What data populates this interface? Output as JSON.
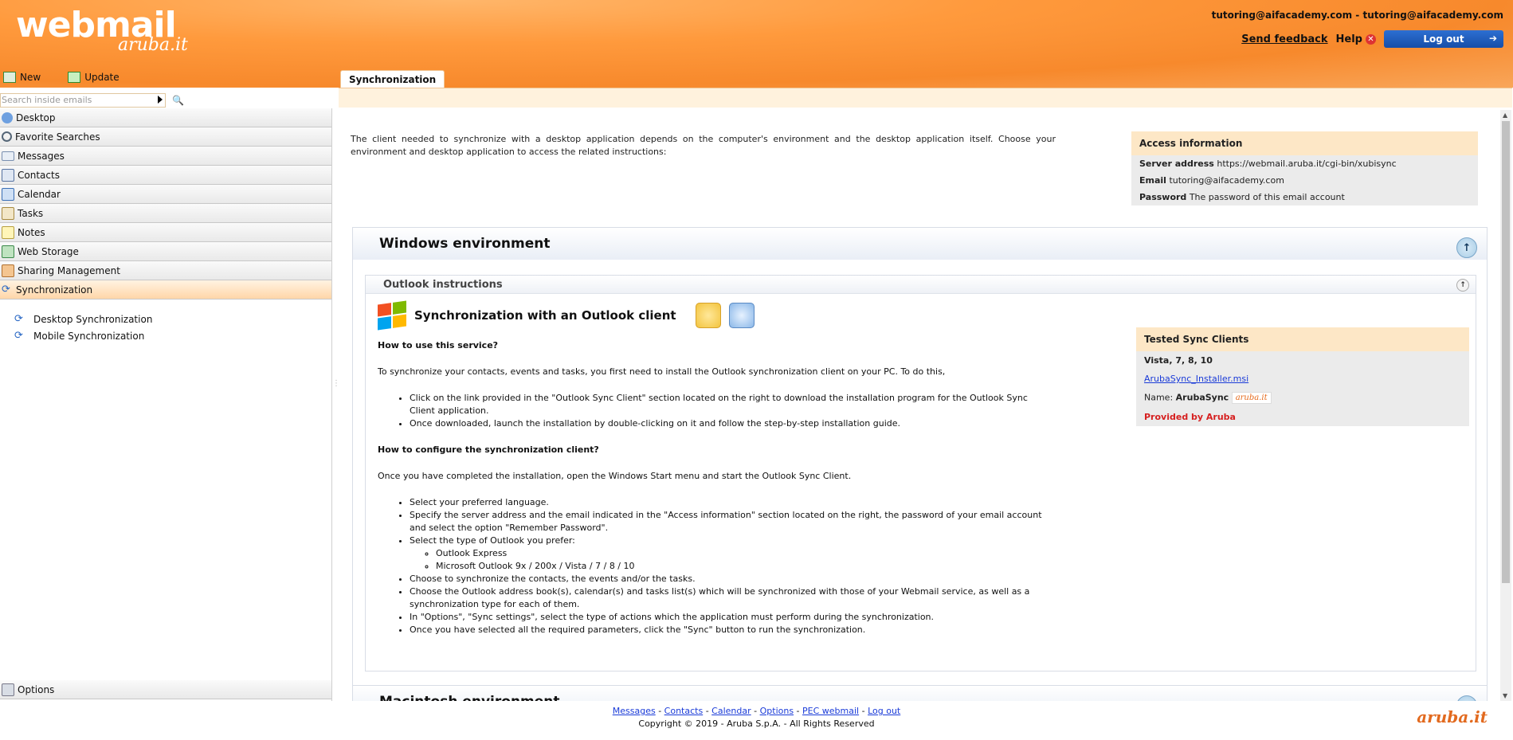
{
  "header": {
    "logo_main": "webmail",
    "logo_sub": "aruba.it",
    "account": "tutoring@aifacademy.com - tutoring@aifacademy.com",
    "feedback": "Send feedback",
    "help": "Help",
    "logout": "Log out"
  },
  "toolbar": {
    "new": "New",
    "update": "Update"
  },
  "search": {
    "placeholder": "Search inside emails"
  },
  "sidebar": {
    "items": [
      {
        "label": "Desktop",
        "icon": "desktop-icon"
      },
      {
        "label": "Favorite Searches",
        "icon": "search-icon"
      },
      {
        "label": "Messages",
        "icon": "envelope-icon"
      },
      {
        "label": "Contacts",
        "icon": "contacts-icon"
      },
      {
        "label": "Calendar",
        "icon": "calendar-icon"
      },
      {
        "label": "Tasks",
        "icon": "tasks-icon"
      },
      {
        "label": "Notes",
        "icon": "notes-icon"
      },
      {
        "label": "Web Storage",
        "icon": "storage-icon"
      },
      {
        "label": "Sharing Management",
        "icon": "sharing-icon"
      },
      {
        "label": "Synchronization",
        "icon": "sync-icon"
      }
    ],
    "sub_items": [
      "Desktop Synchronization",
      "Mobile Synchronization"
    ],
    "options": "Options"
  },
  "main": {
    "tab": "Synchronization",
    "intro": "The client needed to synchronize with a desktop application depends on the computer's environment and the desktop application itself. Choose your environment and desktop application to access the related instructions:",
    "access": {
      "title": "Access information",
      "server_label": "Server address",
      "server_value": "https://webmail.aruba.it/cgi-bin/xubisync",
      "email_label": "Email",
      "email_value": "tutoring@aifacademy.com",
      "password_label": "Password",
      "password_value": "The password of this email account"
    },
    "windows": {
      "title": "Windows environment",
      "outlook_title": "Outlook instructions",
      "sync_title": "Synchronization with an Outlook client",
      "how_use": "How to use this service?",
      "intro_install": "To synchronize your contacts, events and tasks, you first need to install the Outlook synchronization client on your PC. To do this,",
      "install_steps": [
        "Click on the link provided in the \"Outlook Sync Client\" section located on the right to download the installation program for the Outlook Sync Client application.",
        "Once downloaded, launch the installation by double-clicking on it and follow the step-by-step installation guide."
      ],
      "how_config": "How to configure the synchronization client?",
      "config_intro": "Once you have completed the installation, open the Windows Start menu and start the Outlook Sync Client.",
      "config_steps": {
        "s1": "Select your preferred language.",
        "s2": "Specify the server address and the email indicated in the \"Access information\" section located on the right, the password of your email account and select the option \"Remember Password\".",
        "s3": "Select the type of Outlook you prefer:",
        "s3a": "Outlook Express",
        "s3b": "Microsoft Outlook 9x / 200x / Vista / 7 / 8 / 10",
        "s4": "Choose to synchronize the contacts, the events and/or the tasks.",
        "s5": "Choose the Outlook address book(s), calendar(s) and tasks list(s) which will be synchronized with those of your Webmail service, as well as a synchronization type for each of them.",
        "s6": "In \"Options\", \"Sync settings\", select the type of actions which the application must perform during the synchronization.",
        "s7": "Once you have selected all the required parameters, click the \"Sync\" button to run the synchronization."
      },
      "tested": {
        "title": "Tested Sync Clients",
        "versions": "Vista, 7, 8, 10",
        "installer": "ArubaSync_Installer.msi",
        "name_label": "Name:",
        "name_value": "ArubaSync",
        "badge": "aruba.it",
        "provided": "Provided by Aruba"
      }
    },
    "mac": {
      "title": "Macintosh environment"
    }
  },
  "footer": {
    "links": [
      "Messages",
      "Contacts",
      "Calendar",
      "Options",
      "PEC webmail",
      "Log out"
    ],
    "copyright": "Copyright © 2019 - Aruba S.p.A. - All Rights Reserved",
    "logo": "aruba.it"
  }
}
